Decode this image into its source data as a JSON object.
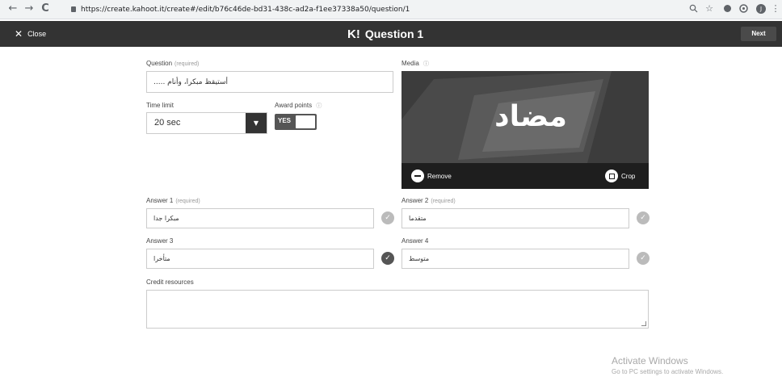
{
  "browser": {
    "url": "https://create.kahoot.it/create#/edit/b76c46de-bd31-438c-ad2a-f1ee37338a50/question/1",
    "back_icon": "←",
    "forward_icon": "→",
    "reload_icon": "C",
    "profile_initial": "J"
  },
  "header": {
    "close_label": "Close",
    "logo": "K!",
    "title": "Question 1",
    "next_label": "Next"
  },
  "question": {
    "label": "Question",
    "required": "(required)",
    "value": "أستيقظ مبكرا، وأنام ....."
  },
  "time_limit": {
    "label": "Time limit",
    "value": "20 sec"
  },
  "award_points": {
    "label": "Award points",
    "toggle_text": "YES",
    "enabled": true
  },
  "media": {
    "label": "Media",
    "image_text": "مضاد",
    "remove_label": "Remove",
    "crop_label": "Crop"
  },
  "answers": [
    {
      "label": "Answer 1",
      "required": "(required)",
      "value": "مبكرا جدا",
      "correct": false
    },
    {
      "label": "Answer 2",
      "required": "(required)",
      "value": "متقدما",
      "correct": false
    },
    {
      "label": "Answer 3",
      "required": "",
      "value": "متأخرا",
      "correct": true
    },
    {
      "label": "Answer 4",
      "required": "",
      "value": "متوسط",
      "correct": false
    }
  ],
  "credit": {
    "label": "Credit resources",
    "value": ""
  },
  "watermark": {
    "title": "Activate Windows",
    "subtitle": "Go to PC settings to activate Windows."
  },
  "colors": {
    "header_bg": "#333333",
    "next_bg": "#4a4a4a",
    "toggle_bg": "#555555"
  }
}
